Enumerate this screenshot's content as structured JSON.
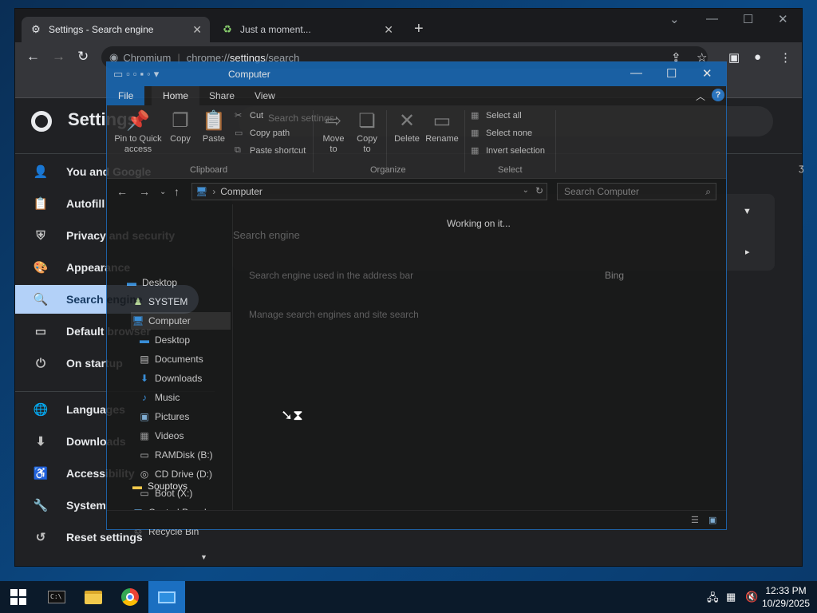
{
  "chrome": {
    "tabs": [
      {
        "label": "Settings - Search engine",
        "icon": "gear-icon"
      },
      {
        "label": "Just a moment...",
        "icon": "loading-icon"
      }
    ],
    "site_name": "Chromium",
    "url_prefix": "chrome://",
    "url_bold": "settings",
    "url_suffix": "/search",
    "settings_title": "Settings",
    "sidebar": [
      {
        "label": "You and Google",
        "icon": "person-icon"
      },
      {
        "label": "Autofill",
        "icon": "clipboard-icon"
      },
      {
        "label": "Privacy and security",
        "icon": "shield-icon"
      },
      {
        "label": "Appearance",
        "icon": "palette-icon"
      },
      {
        "label": "Search engine",
        "icon": "search-icon",
        "selected": true
      },
      {
        "label": "Default browser",
        "icon": "browser-icon"
      },
      {
        "label": "On startup",
        "icon": "power-icon"
      },
      {
        "label": "Languages",
        "icon": "globe-icon"
      },
      {
        "label": "Downloads",
        "icon": "download-icon"
      },
      {
        "label": "Accessibility",
        "icon": "accessibility-icon"
      },
      {
        "label": "System",
        "icon": "wrench-icon"
      },
      {
        "label": "Reset settings",
        "icon": "history-icon"
      }
    ],
    "search_placeholder": "Search settings",
    "section_title": "Search engine",
    "rows": [
      {
        "label": "Search engine used in the address bar",
        "value": "Bing"
      },
      {
        "label": "Manage search engines and site search"
      }
    ]
  },
  "explorer": {
    "title": "Computer",
    "ribbon_tabs": [
      "File",
      "Home",
      "Share",
      "View"
    ],
    "clipboard": {
      "pin_label": "Pin to Quick access",
      "copy": "Copy",
      "paste": "Paste",
      "cut": "Cut",
      "copy_path": "Copy path",
      "paste_shortcut": "Paste shortcut",
      "group": "Clipboard"
    },
    "organize": {
      "move_to": "Move to",
      "copy_to": "Copy to",
      "delete": "Delete",
      "rename": "Rename",
      "group": "Organize"
    },
    "select": {
      "select_all": "Select all",
      "select_none": "Select none",
      "invert": "Invert selection",
      "group": "Select"
    },
    "address": "Computer",
    "search_placeholder": "Search Computer",
    "nav": [
      {
        "label": "Desktop",
        "icon": "desktop-icon",
        "level": 0
      },
      {
        "label": "SYSTEM",
        "icon": "user-icon",
        "level": 1
      },
      {
        "label": "Computer",
        "icon": "computer-icon",
        "level": 1,
        "selected": true
      },
      {
        "label": "Desktop",
        "icon": "desktop-icon",
        "level": 2
      },
      {
        "label": "Documents",
        "icon": "documents-icon",
        "level": 2
      },
      {
        "label": "Downloads",
        "icon": "downloads-icon",
        "level": 2
      },
      {
        "label": "Music",
        "icon": "music-icon",
        "level": 2
      },
      {
        "label": "Pictures",
        "icon": "pictures-icon",
        "level": 2
      },
      {
        "label": "Videos",
        "icon": "videos-icon",
        "level": 2
      },
      {
        "label": "RAMDisk (B:)",
        "icon": "drive-icon",
        "level": 2
      },
      {
        "label": "CD Drive (D:)",
        "icon": "cd-drive-icon",
        "level": 2
      },
      {
        "label": "Boot (X:)",
        "icon": "drive-icon",
        "level": 2
      },
      {
        "label": "Control Panel",
        "icon": "control-panel-icon",
        "level": 1
      },
      {
        "label": "Recycle Bin",
        "icon": "recycle-bin-icon",
        "level": 1
      },
      {
        "label": "Souptoys",
        "icon": "folder-icon",
        "level": 1
      }
    ],
    "status": "Working on it..."
  },
  "taskbar": {
    "time": "12:33 PM",
    "date": "10/29/2025"
  }
}
